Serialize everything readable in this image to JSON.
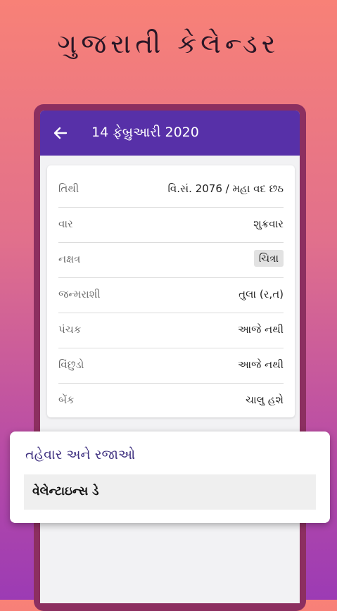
{
  "promo": {
    "title": "ગુજરાતી કેલેન્ડર"
  },
  "app_bar": {
    "title": "14 ફેબ્રુઆરી 2020",
    "back_icon": "arrow-left-icon"
  },
  "details": [
    {
      "label": "તિથી",
      "value": "વિ.સં. 2076 / મહા વદ છઠ"
    },
    {
      "label": "વાર",
      "value": "શુક્રવાર"
    },
    {
      "label": "નક્ષત્ર",
      "value": "ચિત્રા"
    },
    {
      "label": "જન્મરાશી",
      "value": "તુલા (ર,ત)"
    },
    {
      "label": "પંચક",
      "value": "આજે નથી"
    },
    {
      "label": "વિંછુડો",
      "value": "આજે નથી"
    },
    {
      "label": "બેંક",
      "value": "ચાલુ હશે"
    }
  ],
  "festivals": {
    "heading": "તહેવાર અને રજાઓ",
    "items": [
      {
        "label": "વેલેન્ટાઇન્સ ડે"
      }
    ]
  },
  "colors": {
    "app_bar": "#5730a8",
    "heading": "#3f3180",
    "frame": "#8c2f60"
  }
}
